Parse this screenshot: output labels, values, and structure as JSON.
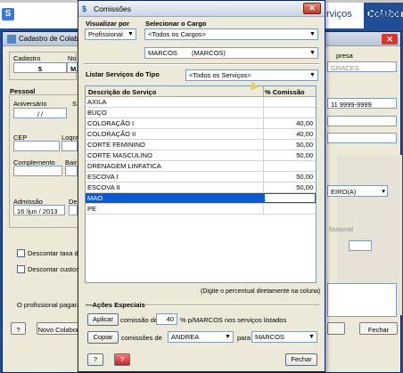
{
  "app": {
    "menu_right_text": "rviços",
    "menu_far_right": "Colabor"
  },
  "background_window": {
    "title": "Cadastro de Colabo",
    "cadastro_label": "Cadastro",
    "cadastro_value": "5",
    "nome_label": "No",
    "nome_value": "MA",
    "empresa_label": "presa",
    "empresa_value": "GRACES",
    "pessoal_label": "Pessoal",
    "aniversario_label": "Aniversário",
    "aniversario_value": "/ /",
    "s_label": "S",
    "cep_label": "CEP",
    "logra_label": "Logra",
    "telefone_value": "11 9999-9999",
    "complemento_label": "Complemento",
    "bairro_label": "Bairr",
    "admissao_label": "Admissão",
    "admissao_value": "16 /jun / 2013",
    "de_label": "De",
    "cargo_value": "EIRO(A)",
    "fissional_label": "fissional",
    "desc_taxa_label": "Descontar taxa de",
    "desc_custos_label": "Descontar custos d",
    "profissional_pagara_label": "O profissional pagará",
    "help_label": "?",
    "novo_label": "Novo Colabor",
    "fechar_label": "Fechar"
  },
  "dialog": {
    "title": "Comissões",
    "close_label": "✕",
    "visualizar_label": "Visualizar por",
    "visualizar_value": "Profissional",
    "selecionar_label": "Selecionar o Cargo",
    "cargo_value": "<Todos os Cargos>",
    "profissional_code": "MARCOS",
    "profissional_name": "(MARCOS)",
    "listar_label": "Listar Serviços do Tipo",
    "tipo_value": "<Todos os Serviços>",
    "grid": {
      "col_descricao": "Descrição do Serviço",
      "col_comissao": "% Comissão",
      "rows": [
        {
          "name": "AXILA",
          "value": ""
        },
        {
          "name": "BUÇO",
          "value": ""
        },
        {
          "name": "COLORAÇÃO I",
          "value": "40,00"
        },
        {
          "name": "COLORAÇÃO II",
          "value": "40,00"
        },
        {
          "name": "CORTE FEMININO",
          "value": "50,00"
        },
        {
          "name": "CORTE MASCULINO",
          "value": "50,00"
        },
        {
          "name": "DRENAGEM LINFATICA",
          "value": ""
        },
        {
          "name": "ESCOVA I",
          "value": "50,00"
        },
        {
          "name": "ESCOVA II",
          "value": "50,00"
        },
        {
          "name": "MAO",
          "value": ""
        },
        {
          "name": "PE",
          "value": ""
        }
      ]
    },
    "hint": "(Digite o percentual diretamente na coluna)",
    "acoes_label": "Ações Especiais",
    "aplicar_label": "Aplicar",
    "comissao_de_label": "comissão de",
    "comissao_value": "40",
    "percent_text": "% p/MARCOS nos serviços listados",
    "copiar_label": "Copiar",
    "comissoes_de_label": "comissões de",
    "from_value": "ANDREA",
    "para_label": "para",
    "to_value": "MARCOS",
    "help_label": "?",
    "help2_label": "?",
    "fechar_label": "Fechar"
  }
}
